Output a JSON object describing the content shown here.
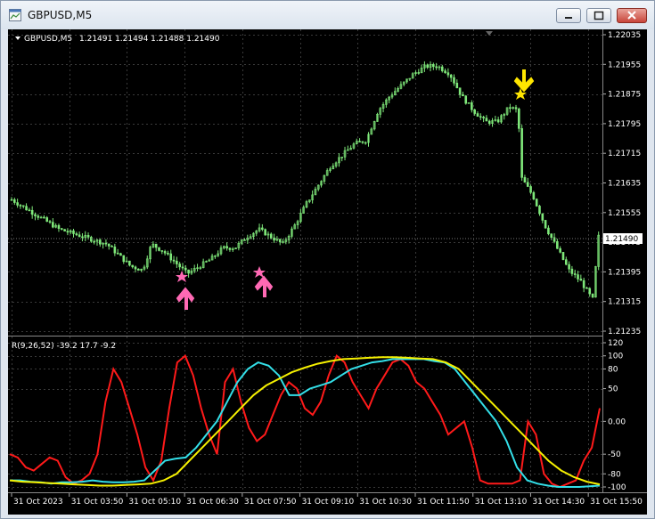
{
  "window": {
    "title": "GBPUSD,M5",
    "buttons": [
      "minimize",
      "maximize",
      "close"
    ]
  },
  "chart_header": {
    "symbol": "GBPUSD,M5",
    "ohlc": "1.21491 1.21494 1.21488 1.21490"
  },
  "indicator_header": {
    "label": "R(9,26,52) -39.2 17.7 -9.2"
  },
  "colors": {
    "background": "#000000",
    "candles": "#7fe87a",
    "grid": "#3a3a3a",
    "price_text": "#ffffff",
    "buy_arrow": "#ff69b4",
    "sell_arrow": "#ffe600",
    "line_red": "#ff1a1a",
    "line_cyan": "#33dfe8",
    "line_yellow": "#f5f000"
  },
  "chart_data": [
    {
      "type": "candlestick",
      "symbol": "GBPUSD",
      "timeframe": "M5",
      "last_price": "1.21490",
      "price_axis_labels": [
        "1.22035",
        "1.21955",
        "1.21875",
        "1.21795",
        "1.21715",
        "1.21635",
        "1.21555",
        "1.21475",
        "1.21395",
        "1.21315",
        "1.21235"
      ],
      "price_levels": [
        1.22035,
        1.21955,
        1.21875,
        1.21795,
        1.21715,
        1.21635,
        1.21555,
        1.21475,
        1.21395,
        1.21315,
        1.21235
      ],
      "ylim": [
        1.21235,
        1.22035
      ],
      "time_labels": [
        "31 Oct 2023",
        "31 Oct 03:50",
        "31 Oct 05:10",
        "31 Oct 06:30",
        "31 Oct 07:50",
        "31 Oct 09:10",
        "31 Oct 10:30",
        "31 Oct 11:50",
        "31 Oct 13:10",
        "31 Oct 14:30",
        "31 Oct 15:50"
      ],
      "approx_close_path": [
        [
          0,
          1.2159
        ],
        [
          4,
          1.2157
        ],
        [
          8,
          1.2155
        ],
        [
          12,
          1.2153
        ],
        [
          16,
          1.2151
        ],
        [
          20,
          1.215
        ],
        [
          24,
          1.2149
        ],
        [
          28,
          1.2148
        ],
        [
          32,
          1.2147
        ],
        [
          36,
          1.2144
        ],
        [
          40,
          1.2141
        ],
        [
          44,
          1.214
        ],
        [
          47,
          1.2147
        ],
        [
          51,
          1.2145
        ],
        [
          55,
          1.2142
        ],
        [
          59,
          1.2139
        ],
        [
          63,
          1.2141
        ],
        [
          67,
          1.2143
        ],
        [
          71,
          1.2146
        ],
        [
          75,
          1.2146
        ],
        [
          79,
          1.2149
        ],
        [
          83,
          1.2151
        ],
        [
          87,
          1.2149
        ],
        [
          91,
          1.2147
        ],
        [
          95,
          1.2152
        ],
        [
          99,
          1.2158
        ],
        [
          103,
          1.2163
        ],
        [
          107,
          1.2168
        ],
        [
          111,
          1.2171
        ],
        [
          115,
          1.2174
        ],
        [
          119,
          1.2175
        ],
        [
          123,
          1.2183
        ],
        [
          127,
          1.2187
        ],
        [
          131,
          1.219
        ],
        [
          135,
          1.2193
        ],
        [
          139,
          1.2195
        ],
        [
          143,
          1.2195
        ],
        [
          147,
          1.2193
        ],
        [
          151,
          1.2187
        ],
        [
          155,
          1.2183
        ],
        [
          159,
          1.218
        ],
        [
          163,
          1.218
        ],
        [
          167,
          1.2184
        ],
        [
          170,
          1.2183
        ],
        [
          171,
          1.2165
        ],
        [
          175,
          1.216
        ],
        [
          179,
          1.2152
        ],
        [
          183,
          1.2146
        ],
        [
          187,
          1.214
        ],
        [
          191,
          1.2137
        ],
        [
          195,
          1.2132
        ],
        [
          197,
          1.2149
        ]
      ]
    },
    {
      "type": "line",
      "name": "R(9,26,52)",
      "values_current": [
        -39.2,
        17.7,
        -9.2
      ],
      "axis_labels": [
        "120",
        "100",
        "80",
        "50",
        "0.00",
        "-50",
        "-80",
        "-100"
      ],
      "axis_levels": [
        120,
        100,
        80,
        50,
        0,
        -50,
        -80,
        -100
      ],
      "ylim": [
        -100,
        120
      ],
      "series": [
        {
          "color": "red",
          "values": [
            -50,
            -55,
            -70,
            -75,
            -65,
            -55,
            -60,
            -85,
            -95,
            -90,
            -80,
            -50,
            30,
            80,
            60,
            20,
            -20,
            -70,
            -90,
            -60,
            20,
            90,
            100,
            70,
            20,
            -20,
            -50,
            60,
            80,
            30,
            -10,
            -30,
            -20,
            10,
            40,
            60,
            50,
            20,
            10,
            30,
            70,
            100,
            90,
            60,
            40,
            20,
            50,
            70,
            90,
            95,
            85,
            60,
            50,
            30,
            10,
            -20,
            -10,
            0,
            -40,
            -90,
            -95,
            -95,
            -95,
            -95,
            -90,
            0,
            -20,
            -80,
            -95,
            -100,
            -95,
            -90,
            -60,
            -40,
            20
          ]
        },
        {
          "color": "cyan",
          "values": [
            -90,
            -90,
            -92,
            -93,
            -95,
            -93,
            -93,
            -92,
            -90,
            -92,
            -93,
            -93,
            -92,
            -90,
            -75,
            -60,
            -57,
            -55,
            -40,
            -20,
            0,
            30,
            60,
            80,
            90,
            85,
            70,
            40,
            40,
            50,
            55,
            60,
            70,
            80,
            85,
            90,
            92,
            95,
            95,
            95,
            95,
            92,
            90,
            80,
            60,
            40,
            20,
            0,
            -30,
            -70,
            -90,
            -95,
            -98,
            -100,
            -100,
            -100,
            -99,
            -98
          ]
        },
        {
          "color": "yellow",
          "values": [
            -90,
            -92,
            -93,
            -94,
            -95,
            -96,
            -97,
            -98,
            -98,
            -97,
            -96,
            -95,
            -90,
            -80,
            -60,
            -40,
            -20,
            0,
            20,
            40,
            55,
            65,
            75,
            82,
            88,
            92,
            95,
            96,
            97,
            98,
            98,
            97,
            96,
            95,
            90,
            80,
            60,
            40,
            20,
            0,
            -20,
            -40,
            -60,
            -75,
            -85,
            -92,
            -96
          ]
        }
      ]
    }
  ]
}
